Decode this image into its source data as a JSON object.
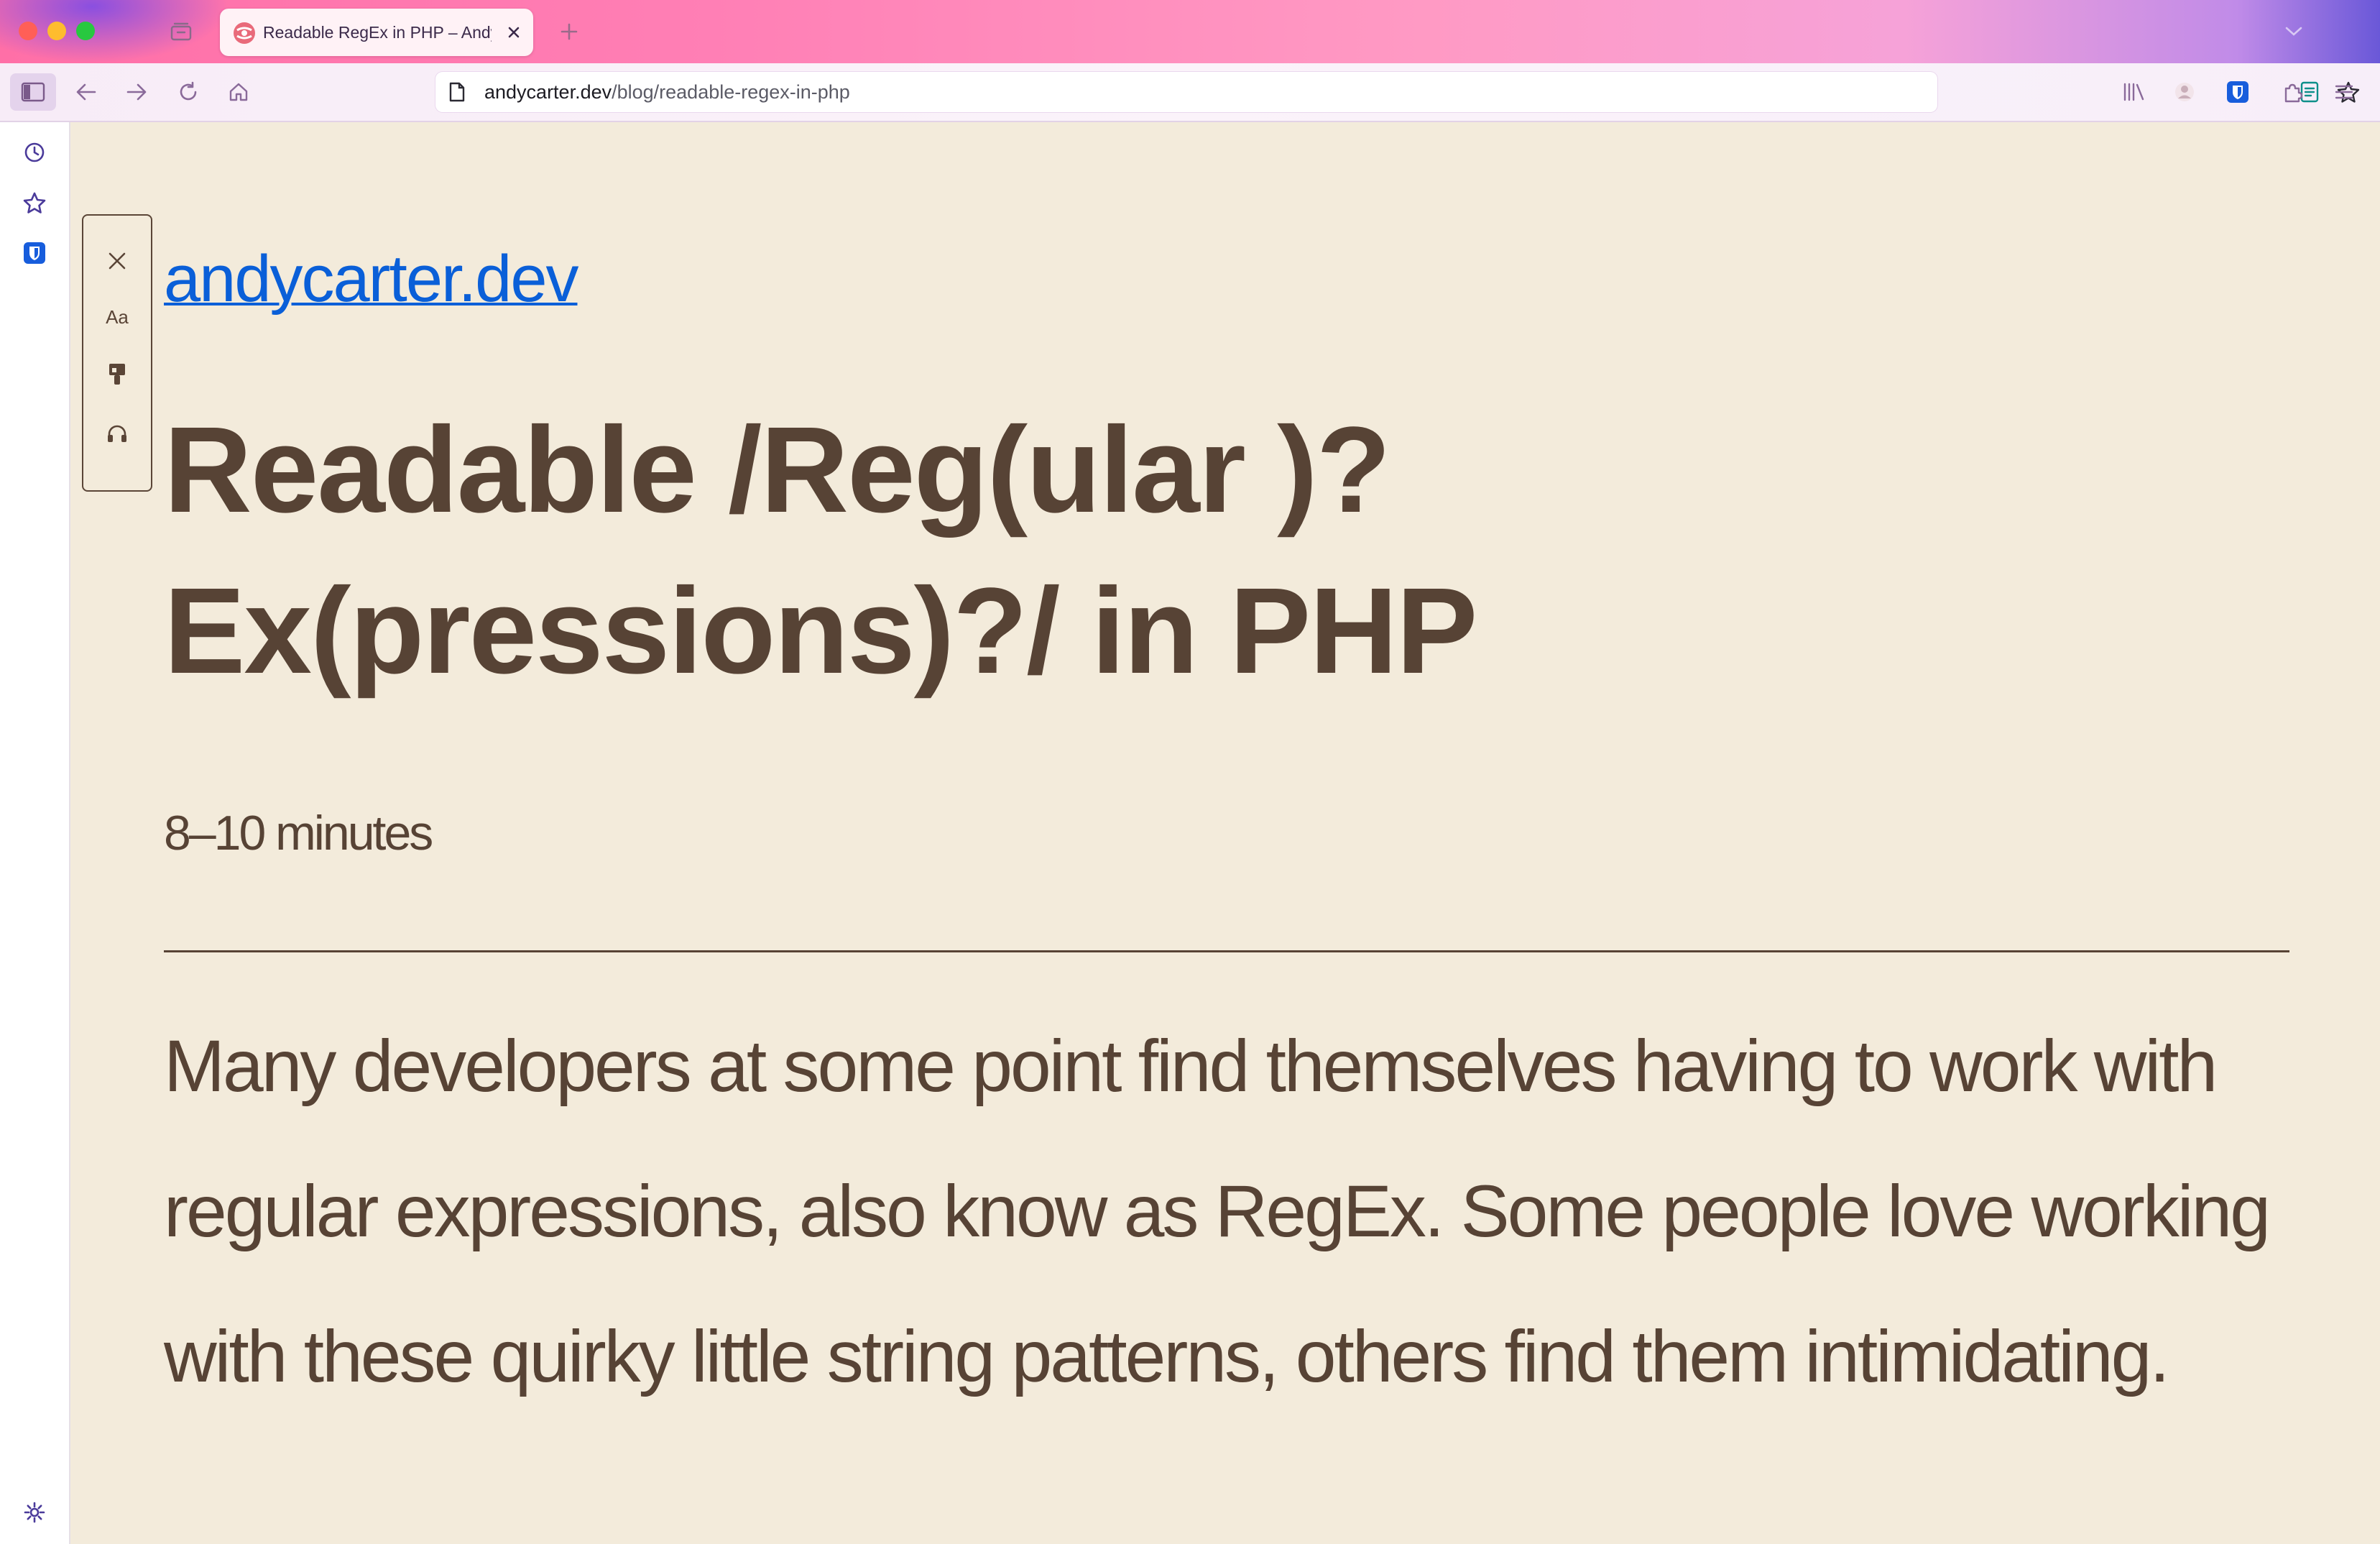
{
  "browser": {
    "tab": {
      "title": "Readable RegEx in PHP – Andy C",
      "favicon": "andycarter-logo-icon"
    },
    "url": {
      "domain": "andycarter.dev",
      "path": "/blog/readable-regex-in-php"
    },
    "icons": {
      "tabs_overview": "tabs-overview-icon",
      "new_tab": "plus-icon",
      "tab_list": "chevron-down-icon",
      "sidebar_toggle": "sidebar-icon",
      "back": "arrow-left-icon",
      "forward": "arrow-right-icon",
      "reload": "reload-icon",
      "home": "home-icon",
      "page_info": "page-icon",
      "reader_view": "reader-view-icon",
      "bookmark": "star-icon",
      "library": "library-icon",
      "account": "account-icon",
      "bitwarden": "bitwarden-shield-icon",
      "extensions": "puzzle-icon",
      "menu": "hamburger-menu-icon"
    },
    "colors": {
      "tab_gradient_start": "#ff6fa7",
      "tab_gradient_end": "#6a58d8",
      "accent": "#8a4fe0"
    }
  },
  "sidebar": {
    "items": [
      "history-icon",
      "star-icon",
      "bitwarden-shield-icon",
      "gear-icon"
    ]
  },
  "reader": {
    "toolbar": {
      "close_icon": "close-icon",
      "type_label": "Aa",
      "theme_icon": "paintbrush-icon",
      "listen_icon": "headphones-icon"
    },
    "site_name": "andycarter.dev",
    "title": "Readable /Reg(ular )? Ex(pressions)?/ in PHP",
    "read_time": "8–10 minutes",
    "paragraph": "Many developers at some point find themselves having to work with regular expressions, also know as RegEx. Some people love working with these quirky little string patterns, others find them intimidating.",
    "colors": {
      "background": "#f3ebdb",
      "text": "#574335",
      "link": "#0a5fd8"
    }
  }
}
